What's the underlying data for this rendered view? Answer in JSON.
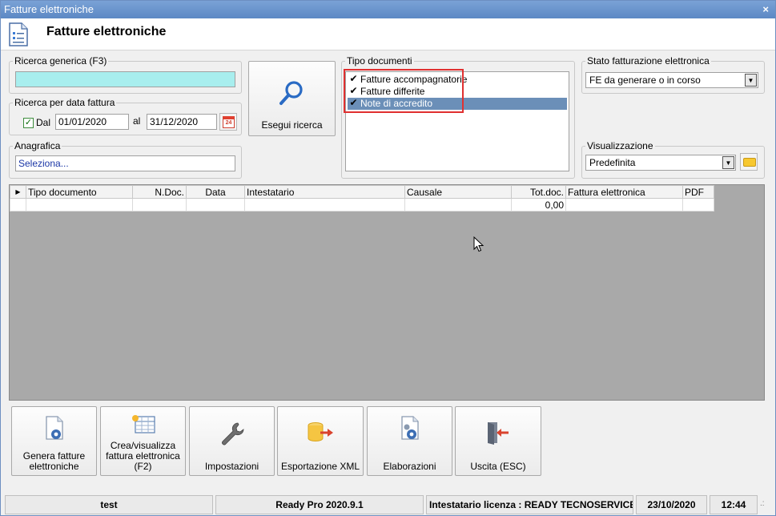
{
  "window": {
    "title": "Fatture elettroniche",
    "close_glyph": "×"
  },
  "header": {
    "title": "Fatture elettroniche",
    "icon": "document-settings-icon"
  },
  "ricerca_generica": {
    "legend": "Ricerca generica (F3)",
    "value": ""
  },
  "ricerca_data": {
    "legend": "Ricerca per data fattura",
    "dal_checked": true,
    "dal_label": "Dal",
    "from_value": "01/01/2020",
    "al_label": "al",
    "to_value": "31/12/2020",
    "calendar_day": "24"
  },
  "anagrafica": {
    "legend": "Anagrafica",
    "value": "Seleziona..."
  },
  "search_button": {
    "label": "Esegui ricerca",
    "icon": "magnifier-icon"
  },
  "tipo_documenti": {
    "legend": "Tipo documenti",
    "items": [
      {
        "label": "Fatture accompagnatorie",
        "checked": true,
        "selected": false
      },
      {
        "label": "Fatture differite",
        "checked": true,
        "selected": false
      },
      {
        "label": "Note di accredito",
        "checked": true,
        "selected": true
      }
    ]
  },
  "stato": {
    "legend": "Stato fatturazione elettronica",
    "value": "FE da generare o in corso"
  },
  "visualizzazione": {
    "legend": "Visualizzazione",
    "value": "Predefinita"
  },
  "grid": {
    "row_marker": "▶",
    "columns": [
      "Tipo documento",
      "N.Doc.",
      "Data",
      "Intestatario",
      "Causale",
      "Tot.doc.",
      "Fattura elettronica",
      "PDF"
    ],
    "rows": [
      [
        "",
        "",
        "",
        "",
        "",
        "0,00",
        "",
        ""
      ]
    ]
  },
  "actions": [
    {
      "label": "Genera fatture elettroniche",
      "icon": "document-gear-icon"
    },
    {
      "label": "Crea/visualizza fattura elettronica (F2)",
      "icon": "grid-sun-icon"
    },
    {
      "label": "Impostazioni",
      "icon": "wrench-icon"
    },
    {
      "label": "Esportazione XML",
      "icon": "database-export-icon"
    },
    {
      "label": "Elaborazioni",
      "icon": "document-gears-icon"
    },
    {
      "label": "Uscita (ESC)",
      "icon": "exit-door-icon"
    }
  ],
  "status": {
    "user": "test",
    "version": "Ready Pro 2020.9.1",
    "license": "Intestatario licenza : READY TECNOSERVICE SF",
    "date": "23/10/2020",
    "time": "12:44",
    "grip": ".:"
  },
  "colors": {
    "title_bar": "#5c88c4",
    "selection": "#6b8fb8",
    "highlight_border": "#e03030",
    "search_field": "#a8eeee"
  }
}
